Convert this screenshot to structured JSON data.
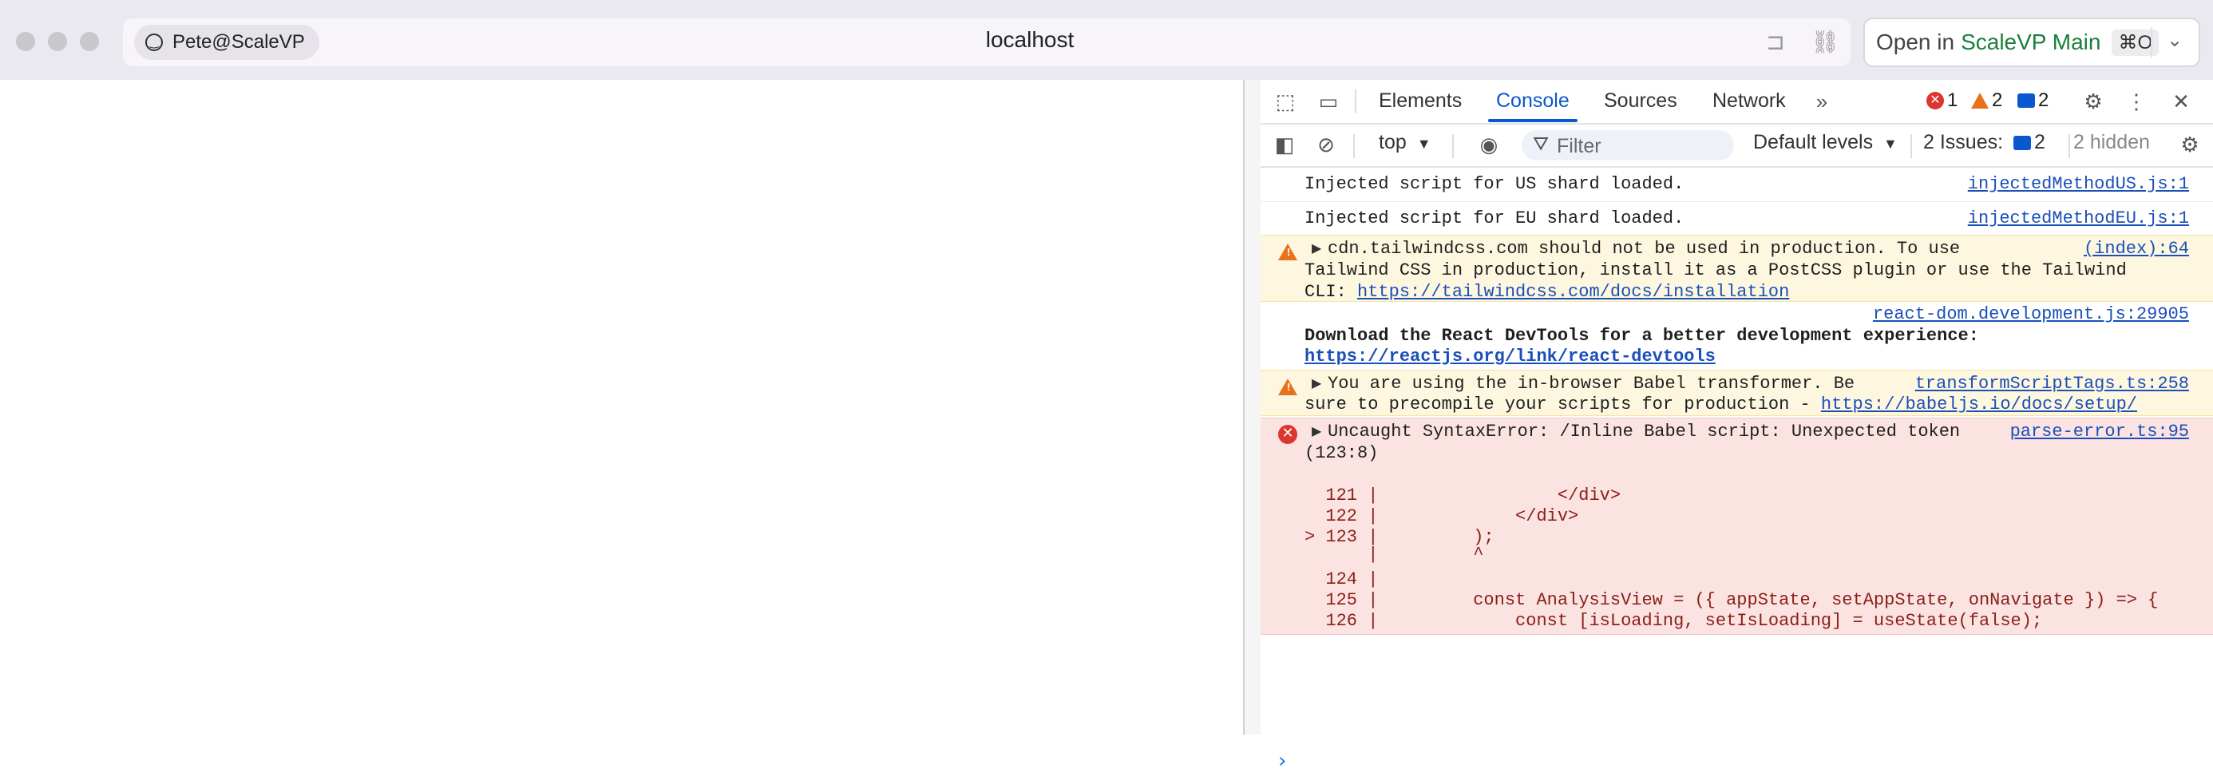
{
  "window": {
    "profile_label": "Pete@ScaleVP",
    "url": "localhost",
    "open_in": {
      "label": "Open in",
      "app": "ScaleVP Main",
      "shortcut": "⌘O"
    }
  },
  "devtools": {
    "tabs": [
      {
        "label": "Elements",
        "active": false
      },
      {
        "label": "Console",
        "active": true
      },
      {
        "label": "Sources",
        "active": false
      },
      {
        "label": "Network",
        "active": false
      }
    ],
    "counts": {
      "errors": "1",
      "warnings": "2",
      "messages": "2"
    },
    "toolbar": {
      "context": "top",
      "filter_placeholder": "Filter",
      "levels": "Default levels",
      "issues_label": "2 Issues:",
      "issues_count": "2",
      "hidden": "2 hidden"
    },
    "console": {
      "log1": {
        "text": "Injected script for US shard loaded.",
        "source": "injectedMethodUS.js:1"
      },
      "log2": {
        "text": "Injected script for EU shard loaded.",
        "source": "injectedMethodEU.js:1"
      },
      "warn1": {
        "line1": "cdn.tailwindcss.com should not be used in production. To use",
        "line2": "Tailwind CSS in production, install it as a PostCSS plugin or use the Tailwind",
        "line3_prefix": "CLI: ",
        "link": "https://tailwindcss.com/docs/installation",
        "source": "(index):64"
      },
      "info1": {
        "source": "react-dom.development.js:29905",
        "text": "Download the React DevTools for a better development experience:",
        "link": "https://reactjs.org/link/react-devtools"
      },
      "warn2": {
        "line1": "You are using the in-browser Babel transformer. Be",
        "line2_prefix": "sure to precompile your scripts for production - ",
        "link": "https://babeljs.io/docs/setup/",
        "source": "transformScriptTags.ts:258"
      },
      "error1": {
        "line1": "Uncaught SyntaxError: /Inline Babel script: Unexpected token",
        "line2": "(123:8)",
        "source": "parse-error.ts:95",
        "code": [
          "  121 |                 </div>",
          "  122 |             </div>",
          "> 123 |         );",
          "      |         ^",
          "  124 |",
          "  125 |         const AnalysisView = ({ appState, setAppState, onNavigate }) => {",
          "  126 |             const [isLoading, setIsLoading] = useState(false);"
        ]
      }
    }
  }
}
